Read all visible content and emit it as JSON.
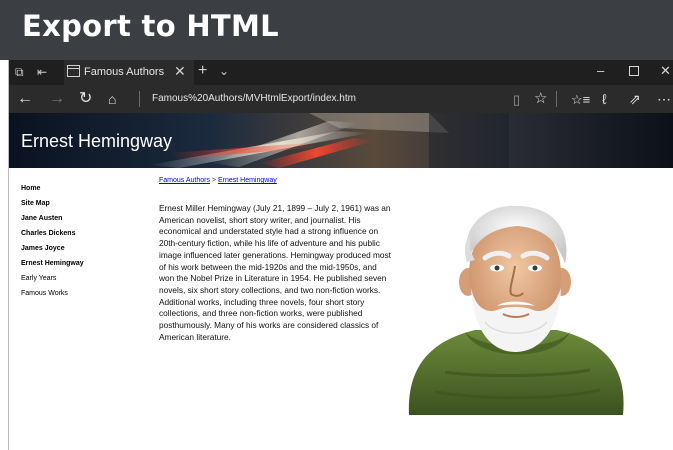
{
  "slide": {
    "title": "Export to HTML"
  },
  "browser": {
    "tab_title": "Famous Authors",
    "address": "Famous%20Authors/MVHtmlExport/index.htm",
    "icons": [
      "tab-preview-icon",
      "set-aside-tabs-icon",
      "tab-page-icon",
      "close-icon",
      "new-tab-icon",
      "tab-menu-icon",
      "minimize-icon",
      "maximize-icon",
      "close-window-icon",
      "back-icon",
      "forward-icon",
      "refresh-icon",
      "home-icon",
      "reading-view-icon",
      "favorite-star-icon",
      "favorites-hub-icon",
      "web-note-icon",
      "share-icon",
      "more-icon"
    ]
  },
  "page": {
    "banner_title": "Ernest Hemingway",
    "sidebar": {
      "items": [
        {
          "label": "Home",
          "bold": true
        },
        {
          "label": "Site Map",
          "bold": true
        },
        {
          "label": "Jane Austen",
          "bold": true
        },
        {
          "label": "Charles Dickens",
          "bold": true
        },
        {
          "label": "James Joyce",
          "bold": true
        },
        {
          "label": "Ernest Hemingway",
          "bold": true
        },
        {
          "label": "Early Years",
          "bold": false
        },
        {
          "label": "Famous Works",
          "bold": false
        }
      ]
    },
    "breadcrumb": {
      "root": "Famous Authors",
      "separator": ">",
      "current": "Ernest Hemingway"
    },
    "article": "Ernest Miller Hemingway (July 21, 1899 – July 2, 1961) was an American novelist, short story writer, and journalist. His economical and understated style had a strong influence on 20th-century fiction, while his life of adventure and his public image influenced later generations. Hemingway produced most of his work between the mid-1920s and the mid-1950s, and won the Nobel Prize in Literature in 1954. He published seven novels, six short story collections, and two non-fiction works. Additional works, including three novels, four short story collections, and three non-fiction works, were published posthumously. Many of his works are considered classics of American literature."
  },
  "colors": {
    "title_bar": "#3b3e43",
    "browser_chrome": "#2b2b2b",
    "link": "#0000ee",
    "sweater": "#4f6b2a"
  }
}
